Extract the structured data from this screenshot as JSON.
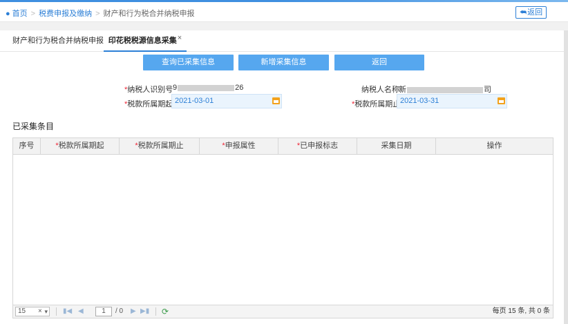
{
  "breadcrumb": {
    "home": "首页",
    "level2": "税费申报及缴纳",
    "level3": "财产和行为税合并纳税申报"
  },
  "header": {
    "back_label": "返回"
  },
  "tabs": [
    {
      "label": "财产和行为税合并纳税申报"
    },
    {
      "label": "印花税税源信息采集",
      "close": "×"
    }
  ],
  "actions": {
    "query_label": "查询已采集信息",
    "add_label": "新增采集信息",
    "back_label": "返回"
  },
  "form": {
    "taxpayer_id_label": "纳税人识别号",
    "taxpayer_id_prefix": "9",
    "taxpayer_id_suffix": "26",
    "taxpayer_name_label": "纳税人名称",
    "taxpayer_name_prefix": "新",
    "taxpayer_name_suffix": "司",
    "period_start_label": "税款所属期起",
    "period_start_value": "2021-03-01",
    "period_end_label": "税款所属期止",
    "period_end_value": "2021-03-31",
    "required_mark": "*"
  },
  "section": {
    "title": "已采集条目"
  },
  "table": {
    "columns": [
      {
        "label": "序号",
        "required": false
      },
      {
        "label": "税款所属期起",
        "required": true
      },
      {
        "label": "税款所属期止",
        "required": true
      },
      {
        "label": "申报属性",
        "required": true
      },
      {
        "label": "已申报标志",
        "required": true
      },
      {
        "label": "采集日期",
        "required": false
      },
      {
        "label": "操作",
        "required": false
      }
    ],
    "rows": []
  },
  "pager": {
    "page_size": "15",
    "clear": "×",
    "current_page": "1",
    "total_pages": "/ 0",
    "summary": "每页 15 条, 共 0 条"
  },
  "colors": {
    "accent": "#2c7fd6",
    "button": "#56a7ef",
    "required": "#ee2233",
    "calendar": "#f3a21c"
  }
}
